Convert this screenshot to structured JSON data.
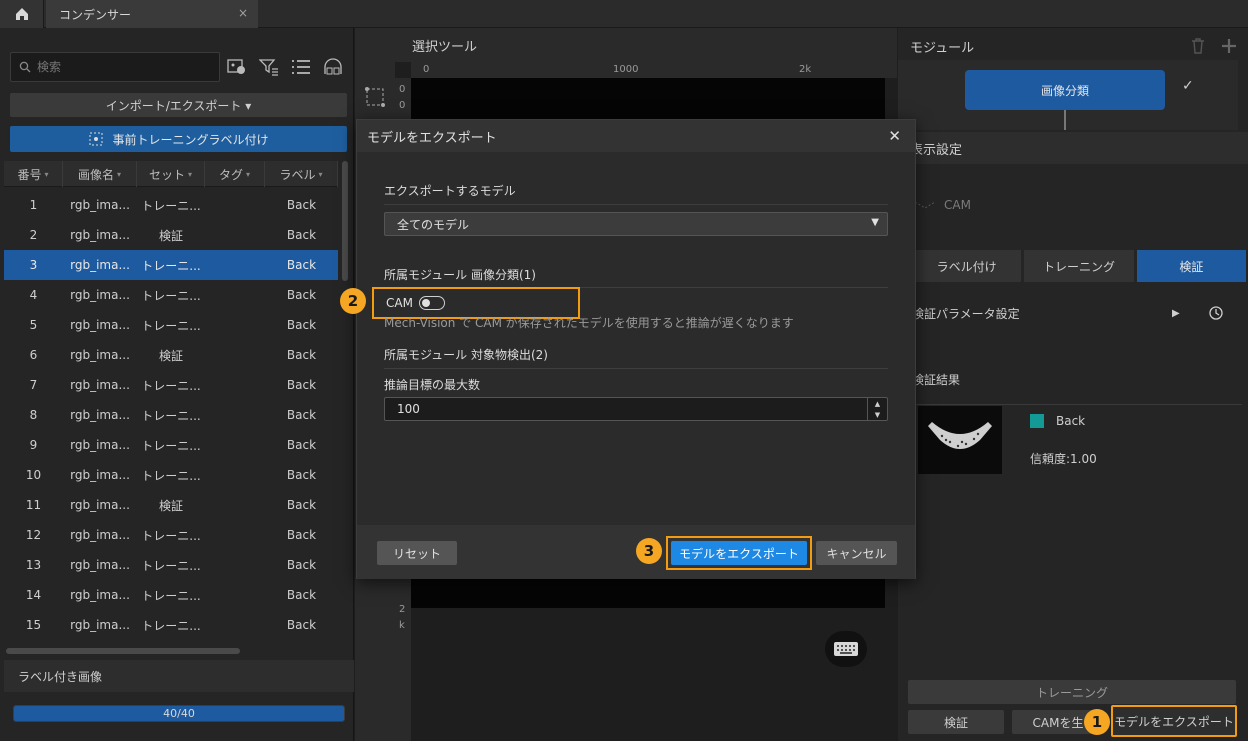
{
  "titlebar": {
    "tab_title": "コンデンサー",
    "close": "×"
  },
  "left": {
    "search_placeholder": "検索",
    "import_export": "インポート/エクスポート ▾",
    "pretrain_label": "事前トレーニングラベル付け",
    "columns": [
      "番号",
      "画像名",
      "セット",
      "タグ",
      "ラベル"
    ],
    "rows": [
      {
        "no": "1",
        "name": "rgb_ima...",
        "set": "トレーニ...",
        "tag": "",
        "label": "Back"
      },
      {
        "no": "2",
        "name": "rgb_ima...",
        "set": "検証",
        "tag": "",
        "label": "Back"
      },
      {
        "no": "3",
        "name": "rgb_ima...",
        "set": "トレーニ...",
        "tag": "",
        "label": "Back"
      },
      {
        "no": "4",
        "name": "rgb_ima...",
        "set": "トレーニ...",
        "tag": "",
        "label": "Back"
      },
      {
        "no": "5",
        "name": "rgb_ima...",
        "set": "トレーニ...",
        "tag": "",
        "label": "Back"
      },
      {
        "no": "6",
        "name": "rgb_ima...",
        "set": "検証",
        "tag": "",
        "label": "Back"
      },
      {
        "no": "7",
        "name": "rgb_ima...",
        "set": "トレーニ...",
        "tag": "",
        "label": "Back"
      },
      {
        "no": "8",
        "name": "rgb_ima...",
        "set": "トレーニ...",
        "tag": "",
        "label": "Back"
      },
      {
        "no": "9",
        "name": "rgb_ima...",
        "set": "トレーニ...",
        "tag": "",
        "label": "Back"
      },
      {
        "no": "10",
        "name": "rgb_ima...",
        "set": "トレーニ...",
        "tag": "",
        "label": "Back"
      },
      {
        "no": "11",
        "name": "rgb_ima...",
        "set": "検証",
        "tag": "",
        "label": "Back"
      },
      {
        "no": "12",
        "name": "rgb_ima...",
        "set": "トレーニ...",
        "tag": "",
        "label": "Back"
      },
      {
        "no": "13",
        "name": "rgb_ima...",
        "set": "トレーニ...",
        "tag": "",
        "label": "Back"
      },
      {
        "no": "14",
        "name": "rgb_ima...",
        "set": "トレーニ...",
        "tag": "",
        "label": "Back"
      },
      {
        "no": "15",
        "name": "rgb_ima...",
        "set": "トレーニ...",
        "tag": "",
        "label": "Back"
      }
    ],
    "selected_row": 2,
    "labeled_header": "ラベル付き画像",
    "progress_text": "40/40",
    "progress_fraction": 1.0
  },
  "center": {
    "title": "選択ツール",
    "ruler_top": [
      "0",
      "1000",
      "2k"
    ],
    "ruler_left": [
      "0",
      "0",
      "2",
      "k"
    ]
  },
  "right": {
    "module_title": "モジュール",
    "module_node": "画像分類",
    "display_settings": "表示設定",
    "cam_label": "CAM",
    "tabs": [
      "ラベル付け",
      "トレーニング",
      "検証"
    ],
    "verify_params": "検証パラメータ設定",
    "verify_results": "検証結果",
    "result_label": "Back",
    "result_conf": "信頼度:1.00",
    "btn_train": "トレーニング",
    "btn_verify": "検証",
    "btn_cam": "CAMを生",
    "btn_export": "モデルをエクスポート"
  },
  "modal": {
    "title": "モデルをエクスポート",
    "export_model_label": "エクスポートするモデル",
    "model_select": "全てのモデル",
    "section1": "所属モジュール 画像分類(1)",
    "cam_label": "CAM",
    "cam_note": "Mech-Vision で CAM が保存されたモデルを使用すると推論が遅くなります",
    "section2": "所属モジュール 対象物検出(2)",
    "max_targets_label": "推論目標の最大数",
    "max_targets_value": "100",
    "reset": "リセット",
    "export": "モデルをエクスポート",
    "cancel": "キャンセル"
  },
  "badges": [
    "1",
    "2",
    "3"
  ],
  "colors": {
    "accent": "#1d5aa0",
    "highlight": "#f39c12",
    "primary_button": "#1e88e5",
    "swatch": "#139a96"
  }
}
